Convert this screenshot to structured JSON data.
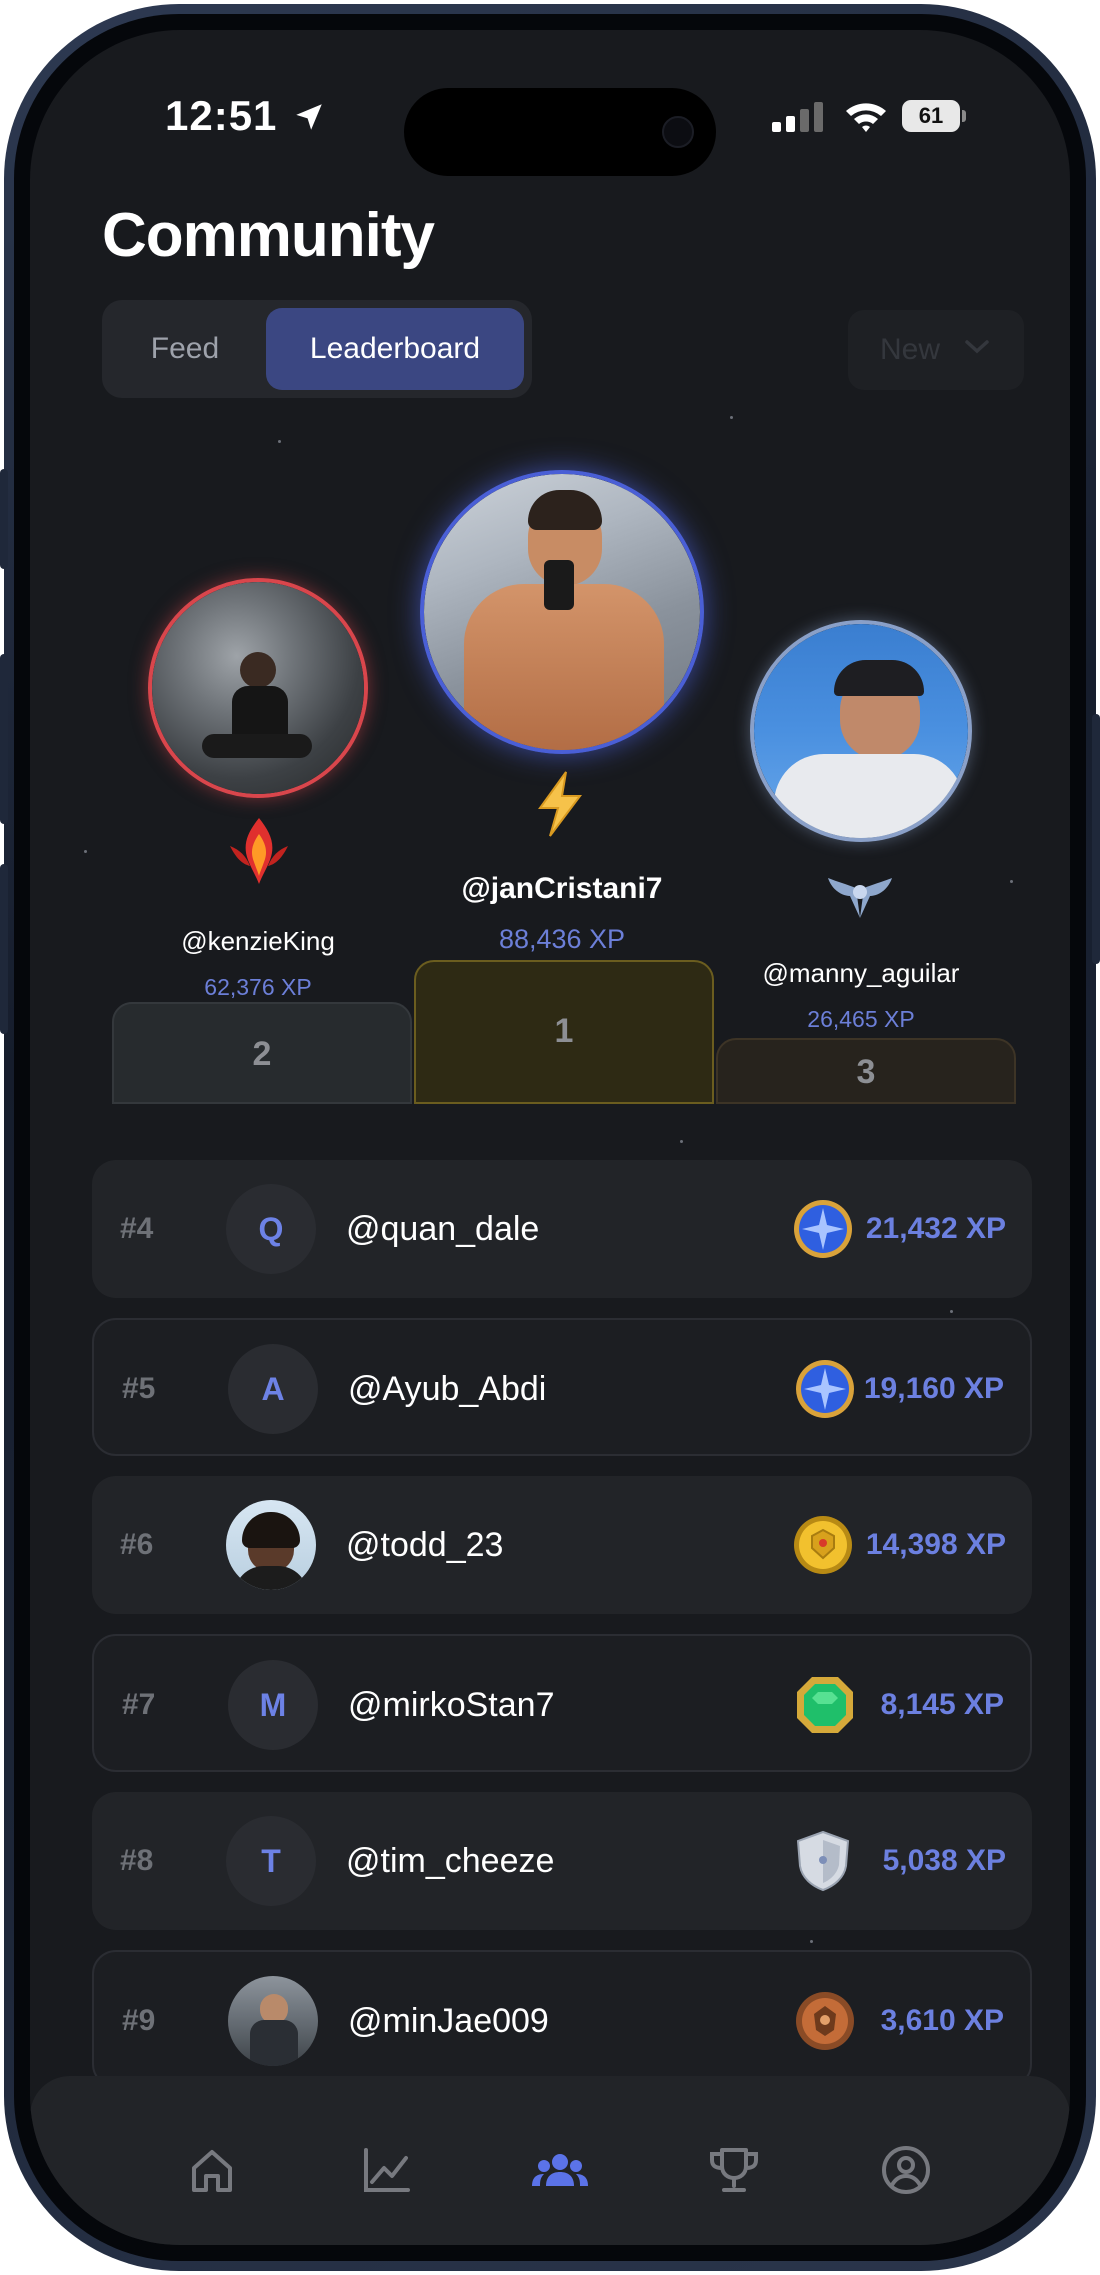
{
  "status_bar": {
    "time": "12:51",
    "battery": "61"
  },
  "header": {
    "title": "Community"
  },
  "segments": {
    "feed_label": "Feed",
    "leaderboard_label": "Leaderboard"
  },
  "sort": {
    "label": "New"
  },
  "podium": {
    "first": {
      "username": "@janCristani7",
      "xp": "88,436 XP",
      "place": "1"
    },
    "second": {
      "username": "@kenzieKing",
      "xp": "62,376 XP",
      "place": "2"
    },
    "third": {
      "username": "@manny_aguilar",
      "xp": "26,465 XP",
      "place": "3"
    }
  },
  "leaderboard": [
    {
      "rank": "#4",
      "initial": "Q",
      "username": "@quan_dale",
      "xp": "21,432 XP",
      "badge": "blue-orb-icon"
    },
    {
      "rank": "#5",
      "initial": "A",
      "username": "@Ayub_Abdi",
      "xp": "19,160 XP",
      "badge": "blue-orb-icon"
    },
    {
      "rank": "#6",
      "initial": "",
      "username": "@todd_23",
      "xp": "14,398 XP",
      "badge": "gold-coin-icon"
    },
    {
      "rank": "#7",
      "initial": "M",
      "username": "@mirkoStan7",
      "xp": "8,145 XP",
      "badge": "emerald-gem-icon"
    },
    {
      "rank": "#8",
      "initial": "T",
      "username": "@tim_cheeze",
      "xp": "5,038 XP",
      "badge": "silver-shield-icon"
    },
    {
      "rank": "#9",
      "initial": "",
      "username": "@minJae009",
      "xp": "3,610 XP",
      "badge": "bronze-medal-icon"
    }
  ],
  "colors": {
    "accent": "#3b4782",
    "xp_text": "#6c80e0",
    "first_glow": "#4a5fd6",
    "second_ring": "#d9464c",
    "background": "#181a1e"
  },
  "tab_bar": [
    "home-icon",
    "chart-icon",
    "community-icon",
    "trophy-icon",
    "profile-icon"
  ]
}
